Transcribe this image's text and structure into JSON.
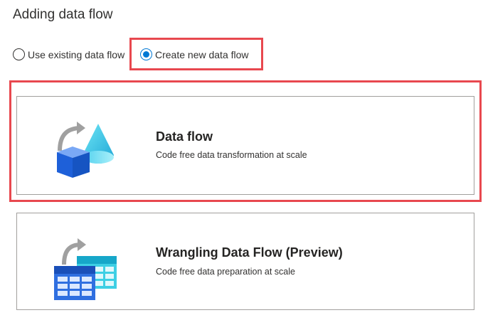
{
  "header": {
    "title": "Adding data flow"
  },
  "mode": {
    "options": [
      {
        "label": "Use existing data flow",
        "selected": false
      },
      {
        "label": "Create new data flow",
        "selected": true
      }
    ]
  },
  "cards": [
    {
      "title": "Data flow",
      "description": "Code free data transformation at scale",
      "icon": "data-flow-icon"
    },
    {
      "title": "Wrangling Data Flow (Preview)",
      "description": "Code free data preparation at scale",
      "icon": "wrangling-data-flow-icon"
    }
  ],
  "colors": {
    "accent": "#0078d4",
    "highlight": "#e8484f",
    "card_border": "#a19f9d"
  }
}
